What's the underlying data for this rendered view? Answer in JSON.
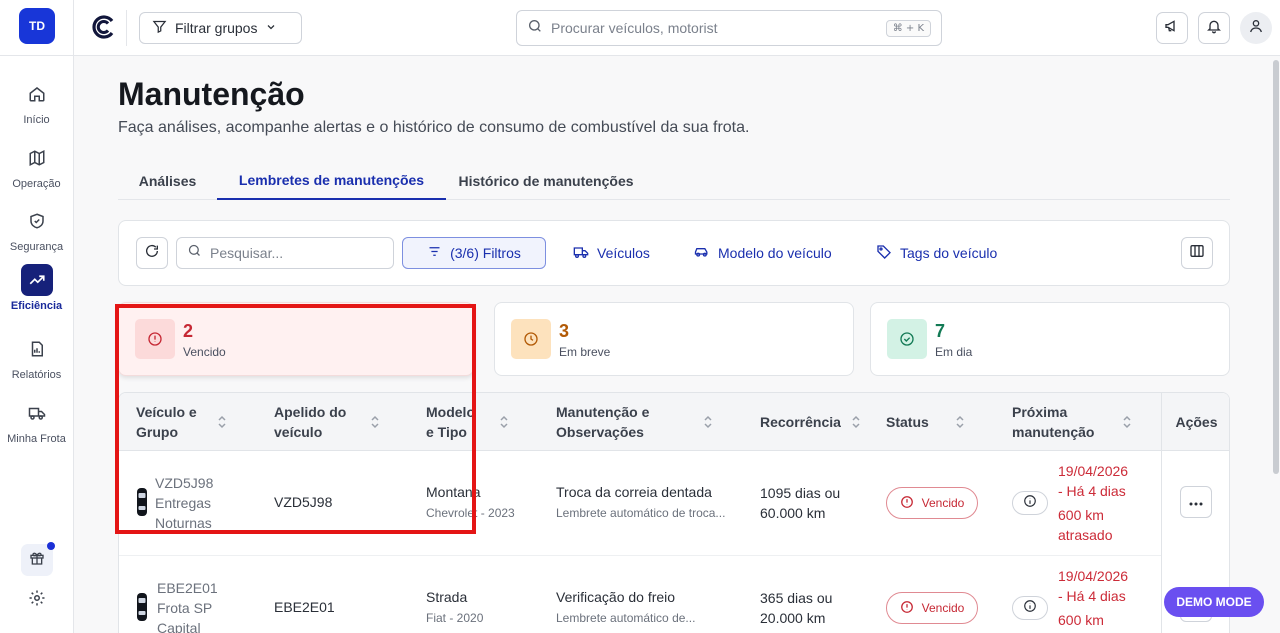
{
  "sidebar": {
    "avatar": "TD",
    "items": [
      {
        "label": "Início",
        "icon": "home-icon"
      },
      {
        "label": "Operação",
        "icon": "map-icon"
      },
      {
        "label": "Segurança",
        "icon": "shield-icon"
      },
      {
        "label": "Eficiência",
        "icon": "trend-up-icon",
        "active": true
      },
      {
        "label": "Relatórios",
        "icon": "document-icon"
      },
      {
        "label": "Minha Frota",
        "icon": "truck-icon"
      }
    ]
  },
  "topbar": {
    "filter_groups": "Filtrar grupos",
    "search_placeholder": "Procurar veículos, motorist",
    "shortcut": "⌘ + K"
  },
  "page": {
    "title": "Manutenção",
    "subtitle": "Faça análises, acompanhe alertas e o histórico de consumo de combustível da sua frota."
  },
  "tabs": [
    {
      "label": "Análises"
    },
    {
      "label": "Lembretes de manutenções",
      "active": true
    },
    {
      "label": "Histórico de manutenções"
    }
  ],
  "toolbar": {
    "search_placeholder": "Pesquisar...",
    "filters": "(3/6) Filtros",
    "vehicles": "Veículos",
    "vehicle_model": "Modelo do veículo",
    "vehicle_tags": "Tags do veículo"
  },
  "cards": [
    {
      "count": "2",
      "label": "Vencido",
      "color": "#c62834",
      "selected": true
    },
    {
      "count": "3",
      "label": "Em breve",
      "color": "#b25a06"
    },
    {
      "count": "7",
      "label": "Em dia",
      "color": "#137a55"
    }
  ],
  "table": {
    "headers": {
      "vehicle": [
        "Veículo e",
        "Grupo"
      ],
      "nickname": [
        "Apelido do",
        "veículo"
      ],
      "model": [
        "Modelo",
        "e Tipo"
      ],
      "maintenance": [
        "Manutenção e",
        "Observações"
      ],
      "recurrence": "Recorrência",
      "status": "Status",
      "next": [
        "Próxima",
        "manutenção"
      ],
      "actions": "Ações"
    },
    "rows": [
      {
        "plate": "VZD5J98",
        "group": [
          "Entregas",
          "Noturnas"
        ],
        "nickname": "VZD5J98",
        "model": "Montana",
        "model_sub": "Chevrolet - 2023",
        "maintenance": "Troca da correia dentada",
        "observation": "Lembrete automático de troca...",
        "recurrence": [
          "1095 dias ou",
          "60.000 km"
        ],
        "status": "Vencido",
        "next": [
          "19/04/2026",
          "- Há 4 dias",
          "600 km",
          "atrasado"
        ]
      },
      {
        "plate": "EBE2E01",
        "group": [
          "Frota SP",
          "Capital"
        ],
        "nickname": "EBE2E01",
        "model": "Strada",
        "model_sub": "Fiat - 2020",
        "maintenance": "Verificação do freio",
        "observation": "Lembrete automático de...",
        "recurrence": [
          "365 dias ou",
          "20.000 km"
        ],
        "status": "Vencido",
        "next": [
          "19/04/2026",
          "- Há 4 dias",
          "600 km"
        ]
      }
    ]
  },
  "demo_mode": "DEMO MODE"
}
